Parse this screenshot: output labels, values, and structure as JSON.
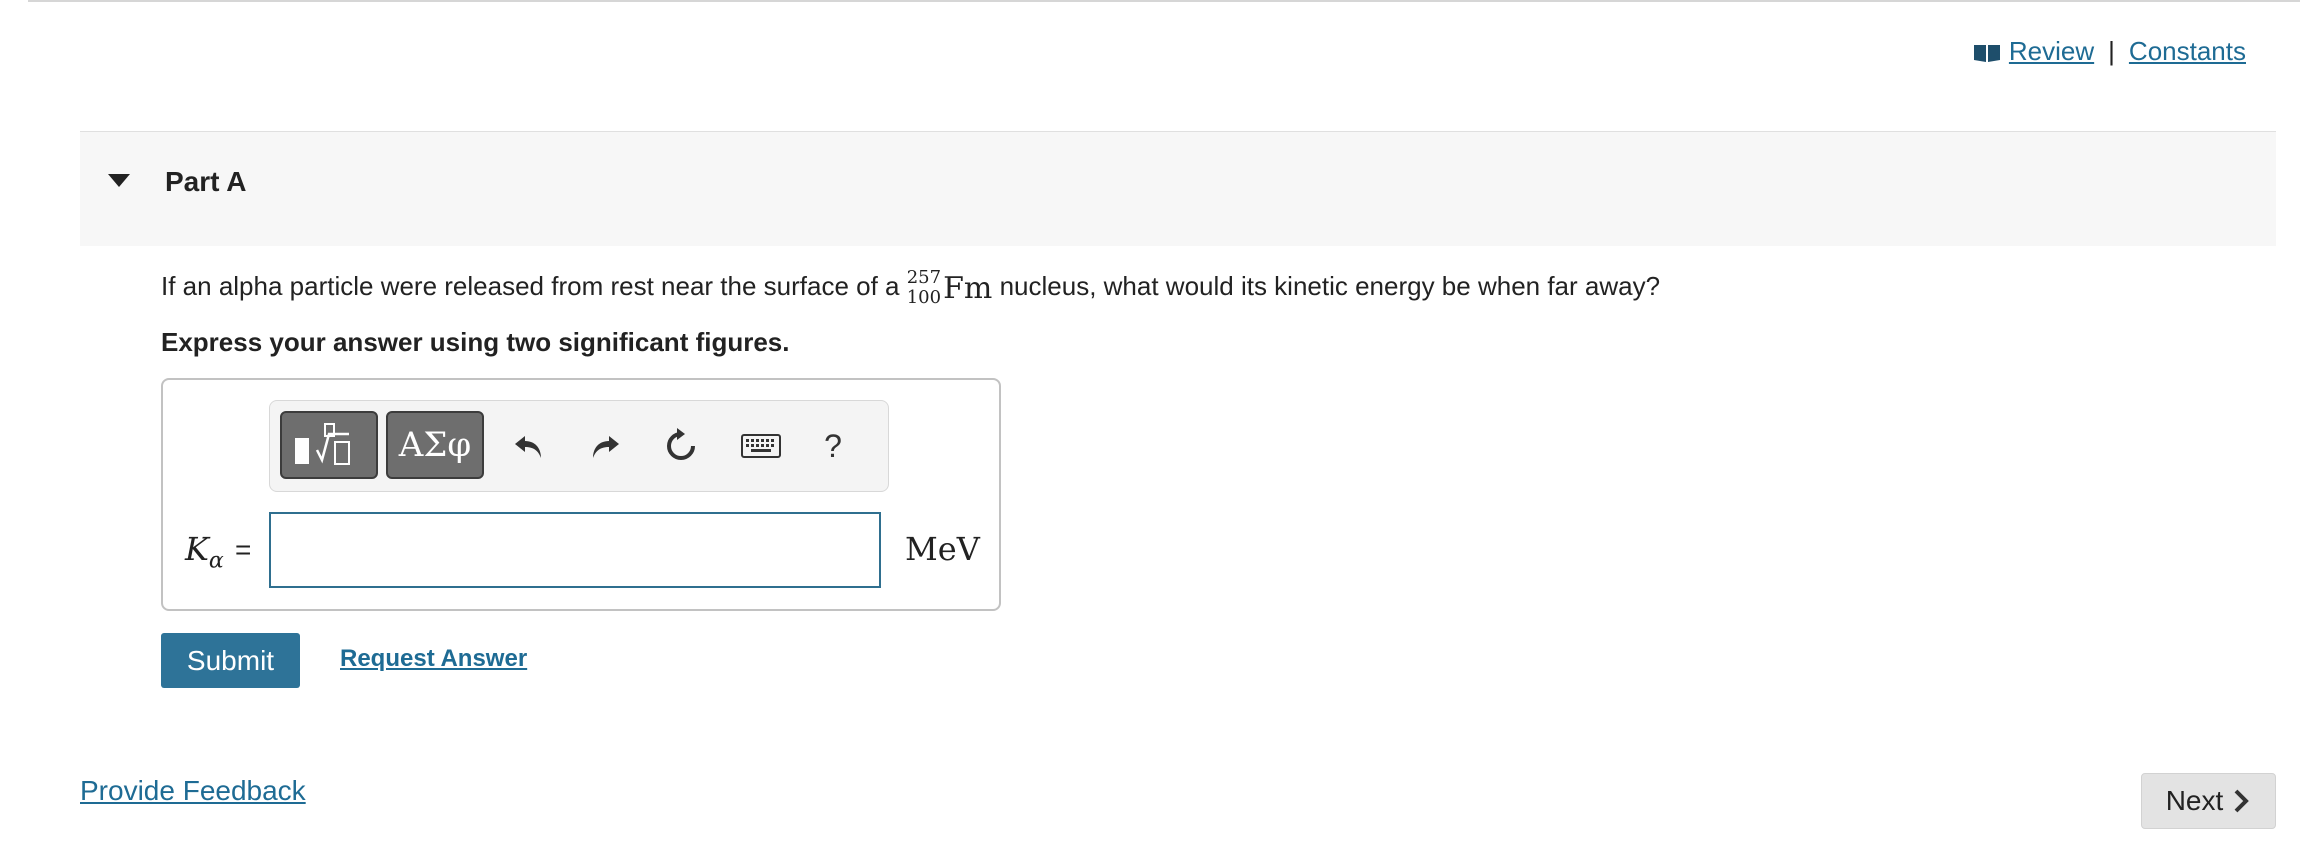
{
  "top_links": {
    "review": "Review",
    "separator": "|",
    "constants": "Constants"
  },
  "part": {
    "title": "Part A"
  },
  "question": {
    "text_before": "If an alpha particle were released from rest near the surface of a ",
    "mass_number": "257",
    "atomic_number": "100",
    "element": "Fm",
    "text_after": " nucleus, what would its kinetic energy be when far away?"
  },
  "instruction": "Express your answer using two significant figures.",
  "answer": {
    "symbol": "K",
    "subscript": "α",
    "equals": "=",
    "value": "",
    "unit": "MeV"
  },
  "toolbar": {
    "symbols_label": "ΑΣφ",
    "help_label": "?"
  },
  "actions": {
    "submit": "Submit",
    "request_answer": "Request Answer"
  },
  "footer": {
    "feedback": "Provide Feedback",
    "next": "Next"
  },
  "colors": {
    "link": "#1e6b94",
    "submit_bg": "#2e7398",
    "input_border": "#2f6f8f",
    "header_bg": "#f7f7f7"
  }
}
